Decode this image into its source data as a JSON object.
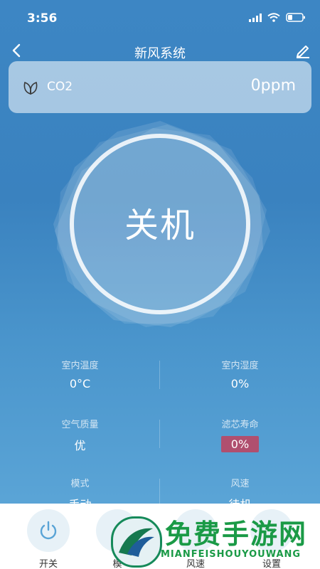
{
  "status_bar": {
    "time": "3:56"
  },
  "nav": {
    "title": "新风系统"
  },
  "co2": {
    "label": "CO2",
    "value": "0ppm"
  },
  "power": {
    "state_text": "关机"
  },
  "stats": {
    "indoor_temp": {
      "label": "室内温度",
      "value": "0°C"
    },
    "indoor_humidity": {
      "label": "室内湿度",
      "value": "0%"
    },
    "air_quality": {
      "label": "空气质量",
      "value": "优"
    },
    "filter_life": {
      "label": "滤芯寿命",
      "value": "0%"
    },
    "mode": {
      "label": "模式",
      "value": "手动"
    },
    "fan_speed": {
      "label": "风速",
      "value": "待机"
    }
  },
  "bottom_bar": {
    "power_label": "开关",
    "mode_label": "模",
    "speed_label": "风速",
    "settings_label": "设置"
  },
  "watermark": {
    "title": "免费手游网",
    "subtitle": "MIANFEISHOUYOUWANG"
  },
  "colors": {
    "background": "#3d86c4",
    "filter_badge": "#b04f6f",
    "watermark_green": "#1a9a46"
  }
}
